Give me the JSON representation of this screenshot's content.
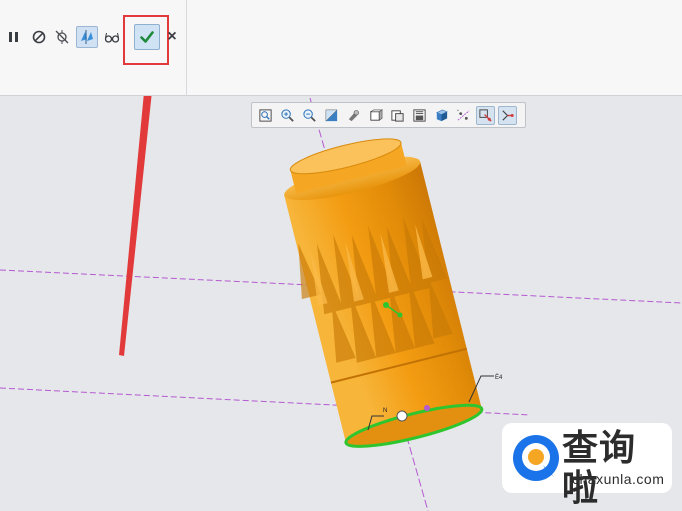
{
  "toolbar": {
    "tools": [
      {
        "name": "pause",
        "icon": "pause-icon"
      },
      {
        "name": "no-entry",
        "icon": "no-entry-icon"
      },
      {
        "name": "pause-tool",
        "icon": "pause-tool-icon"
      },
      {
        "name": "preview",
        "icon": "preview-icon",
        "active": true
      },
      {
        "name": "verify",
        "icon": "glasses-icon"
      }
    ],
    "ok_icon": "checkmark-icon",
    "cancel_label": "×",
    "highlight_color": "#e23a3a"
  },
  "graphics_toolbar": {
    "buttons": [
      "zoom-fit-icon",
      "zoom-in-icon",
      "zoom-out-icon",
      "repaint-icon",
      "orient-icon",
      "display-style-icon",
      "saved-views-icon",
      "view-manager-icon",
      "perspective-icon",
      "datum-display-icon",
      "spin-center-icon",
      "annotation-display-icon"
    ]
  },
  "model": {
    "body_color": "#f39c12",
    "feature_markers": [
      "N",
      "Ё4"
    ]
  },
  "watermark": {
    "title": "查询啦",
    "domain": "chaxunla.com",
    "brand_blue": "#1a73e8",
    "brand_orange": "#f5a623"
  }
}
